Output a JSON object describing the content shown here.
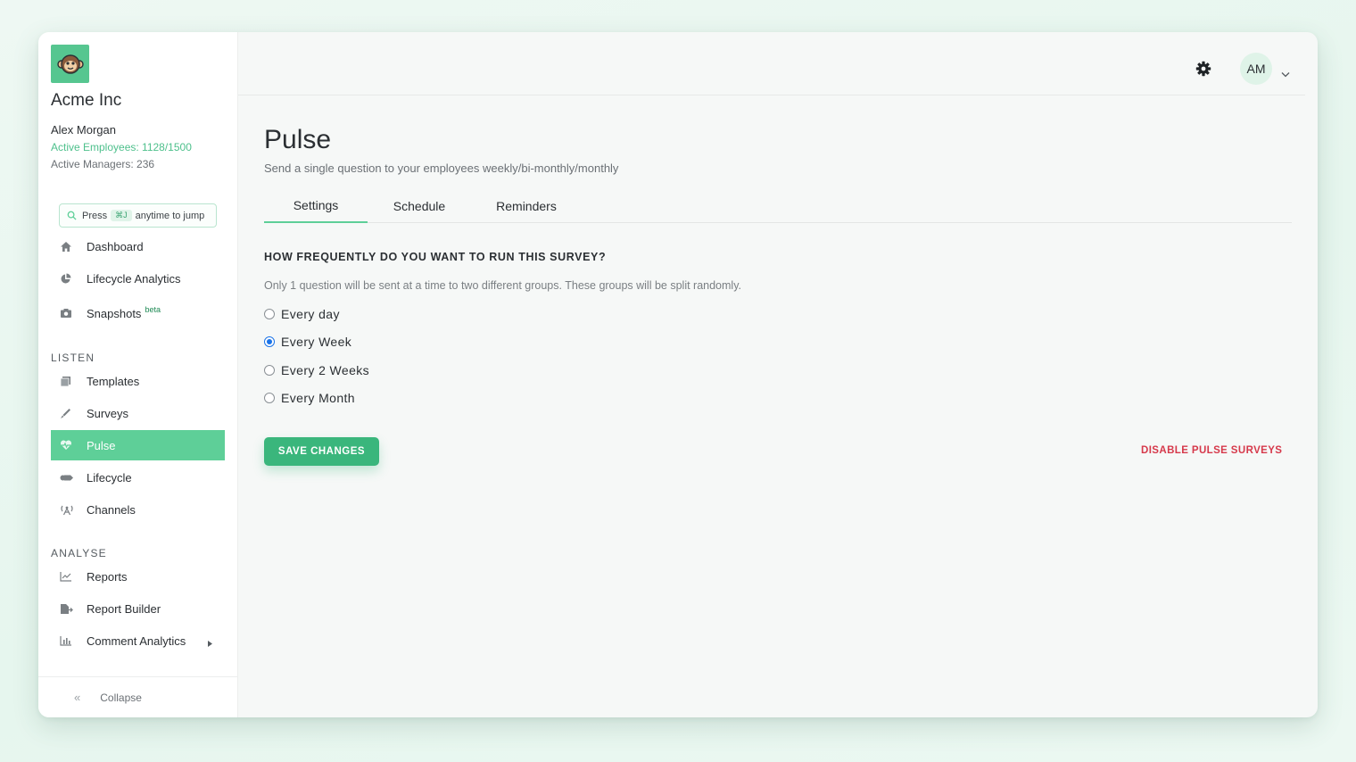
{
  "org": {
    "company_name": "Acme Inc",
    "user_name": "Alex Morgan",
    "active_employees": "Active Employees: 1128/1500",
    "active_managers": "Active Managers: 236"
  },
  "jump": {
    "press": "Press",
    "shortcut": "⌘J",
    "suffix": "anytime to jump"
  },
  "nav": {
    "top_items": [
      {
        "label": "Dashboard",
        "icon": "home-icon"
      },
      {
        "label": "Lifecycle Analytics",
        "icon": "pie-chart-icon"
      },
      {
        "label": "Snapshots",
        "badge": "beta",
        "icon": "camera-icon"
      }
    ],
    "listen_label": "LISTEN",
    "listen_items": [
      {
        "label": "Templates",
        "icon": "templates-icon"
      },
      {
        "label": "Surveys",
        "icon": "pen-icon"
      },
      {
        "label": "Pulse",
        "icon": "heartbeat-icon",
        "active": true
      },
      {
        "label": "Lifecycle",
        "icon": "flag-icon"
      },
      {
        "label": "Channels",
        "icon": "broadcast-icon"
      }
    ],
    "analyse_label": "ANALYSE",
    "analyse_items": [
      {
        "label": "Reports",
        "icon": "line-chart-icon"
      },
      {
        "label": "Report Builder",
        "icon": "file-export-icon"
      },
      {
        "label": "Comment Analytics",
        "icon": "bar-chart-icon",
        "has_submenu": true
      }
    ],
    "collapse_label": "Collapse"
  },
  "header": {
    "avatar_initials": "AM"
  },
  "page": {
    "title": "Pulse",
    "subtitle": "Send a single question to your employees weekly/bi-monthly/monthly",
    "tabs": [
      {
        "label": "Settings",
        "active": true
      },
      {
        "label": "Schedule"
      },
      {
        "label": "Reminders"
      }
    ]
  },
  "survey": {
    "question": "HOW FREQUENTLY DO YOU WANT TO RUN THIS SURVEY?",
    "hint": "Only 1 question will be sent at a time to two different groups. These groups will be split randomly.",
    "options": [
      {
        "label": "Every day",
        "checked": false
      },
      {
        "label": "Every Week",
        "checked": true
      },
      {
        "label": "Every 2 Weeks",
        "checked": false
      },
      {
        "label": "Every Month",
        "checked": false
      }
    ],
    "save_label": "SAVE CHANGES",
    "disable_label": "DISABLE PULSE SURVEYS"
  },
  "colors": {
    "accent": "#5ecf98",
    "primary_button": "#3ab67c",
    "danger": "#d6394b",
    "radio_selected": "#1a73e8"
  }
}
